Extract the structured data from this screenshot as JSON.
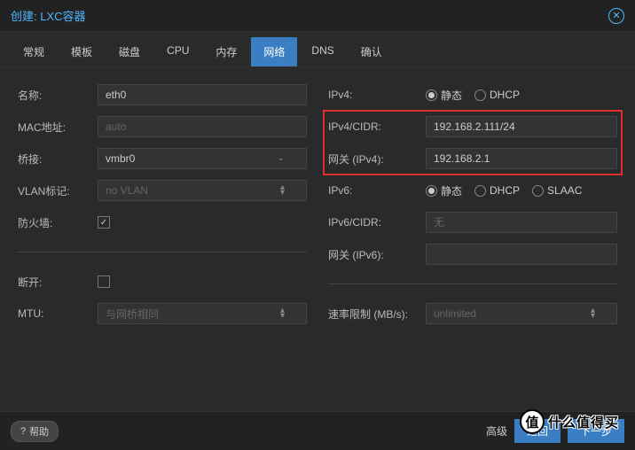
{
  "title": "创建: LXC容器",
  "tabs": [
    "常规",
    "模板",
    "磁盘",
    "CPU",
    "内存",
    "网络",
    "DNS",
    "确认"
  ],
  "activeTab": 5,
  "left": {
    "nameLabel": "名称:",
    "nameValue": "eth0",
    "macLabel": "MAC地址:",
    "macPlaceholder": "auto",
    "bridgeLabel": "桥接:",
    "bridgeValue": "vmbr0",
    "vlanLabel": "VLAN标记:",
    "vlanPlaceholder": "no VLAN",
    "firewallLabel": "防火墙:",
    "disconnectLabel": "断开:",
    "mtuLabel": "MTU:",
    "mtuPlaceholder": "与网桥相同"
  },
  "right": {
    "ipv4Label": "IPv4:",
    "staticLabel": "静态",
    "dhcpLabel": "DHCP",
    "ipv4CidrLabel": "IPv4/CIDR:",
    "ipv4CidrValue": "192.168.2.111/24",
    "gw4Label": "网关 (IPv4):",
    "gw4Value": "192.168.2.1",
    "ipv6Label": "IPv6:",
    "slaacLabel": "SLAAC",
    "ipv6CidrLabel": "IPv6/CIDR:",
    "ipv6CidrPlaceholder": "无",
    "gw6Label": "网关 (IPv6):",
    "rateLabel": "速率限制 (MB/s):",
    "ratePlaceholder": "unlimited"
  },
  "footer": {
    "help": "帮助",
    "advanced": "高级",
    "back": "返回",
    "next": "下一步"
  },
  "watermark": {
    "icon": "值",
    "text": "什么值得买"
  }
}
